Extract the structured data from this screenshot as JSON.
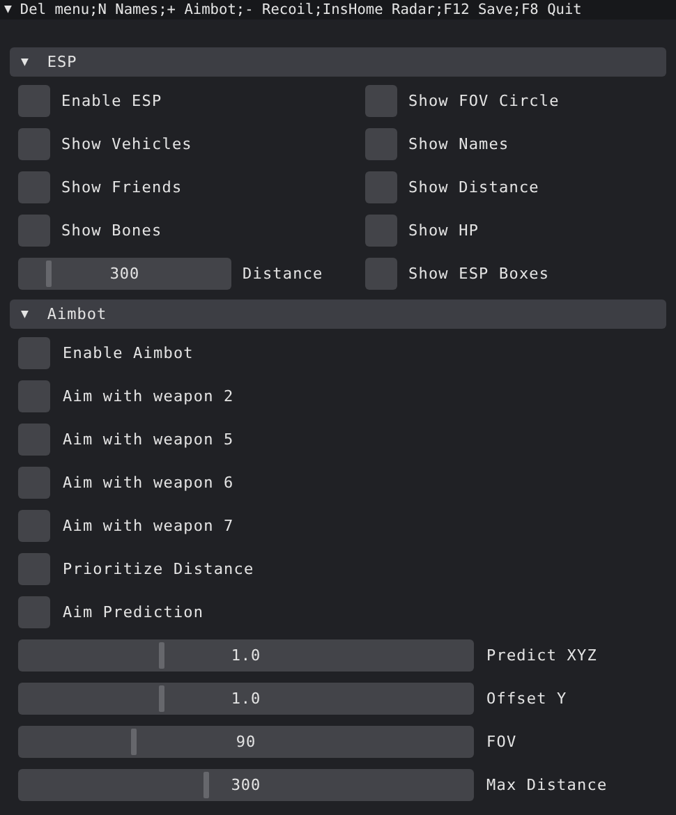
{
  "title_bar": {
    "arrow": "▼",
    "text": "Del menu;N Names;+ Aimbot;- Recoil;InsHome Radar;F12 Save;F8 Quit"
  },
  "sections": [
    {
      "arrow": "▼",
      "title": "ESP",
      "expanded": true,
      "rows": [
        [
          {
            "kind": "checkbox",
            "label": "Enable ESP",
            "checked": false
          },
          {
            "kind": "checkbox",
            "label": "Show FOV Circle",
            "checked": false
          }
        ],
        [
          {
            "kind": "checkbox",
            "label": "Show Vehicles",
            "checked": false
          },
          {
            "kind": "checkbox",
            "label": "Show Names",
            "checked": false
          }
        ],
        [
          {
            "kind": "checkbox",
            "label": "Show Friends",
            "checked": false
          },
          {
            "kind": "checkbox",
            "label": "Show Distance",
            "checked": false
          }
        ],
        [
          {
            "kind": "checkbox",
            "label": "Show Bones",
            "checked": false
          },
          {
            "kind": "checkbox",
            "label": "Show HP",
            "checked": false
          }
        ],
        [
          {
            "kind": "slider",
            "value": "300",
            "label": "Distance",
            "level": 0.13
          },
          {
            "kind": "checkbox",
            "label": "Show ESP Boxes",
            "checked": false
          }
        ]
      ]
    },
    {
      "arrow": "▼",
      "title": "Aimbot",
      "expanded": true,
      "rows": [
        [
          {
            "kind": "checkbox",
            "label": "Enable Aimbot",
            "checked": false
          }
        ],
        [
          {
            "kind": "checkbox",
            "label": "Aim with weapon 2",
            "checked": false
          }
        ],
        [
          {
            "kind": "checkbox",
            "label": "Aim with weapon 5",
            "checked": false
          }
        ],
        [
          {
            "kind": "checkbox",
            "label": "Aim with weapon 6",
            "checked": false
          }
        ],
        [
          {
            "kind": "checkbox",
            "label": "Aim with weapon 7",
            "checked": false
          }
        ],
        [
          {
            "kind": "checkbox",
            "label": "Prioritize Distance",
            "checked": false
          }
        ],
        [
          {
            "kind": "checkbox",
            "label": "Aim Prediction",
            "checked": false
          }
        ],
        [
          {
            "kind": "slider",
            "value": "1.0",
            "label": "Predict XYZ",
            "level": 0.31
          }
        ],
        [
          {
            "kind": "slider",
            "value": "1.0",
            "label": "Offset Y",
            "level": 0.31
          }
        ],
        [
          {
            "kind": "slider",
            "value": "90",
            "label": "FOV",
            "level": 0.25
          }
        ],
        [
          {
            "kind": "slider",
            "value": "300",
            "label": "Max Distance",
            "level": 0.41
          }
        ]
      ]
    }
  ]
}
